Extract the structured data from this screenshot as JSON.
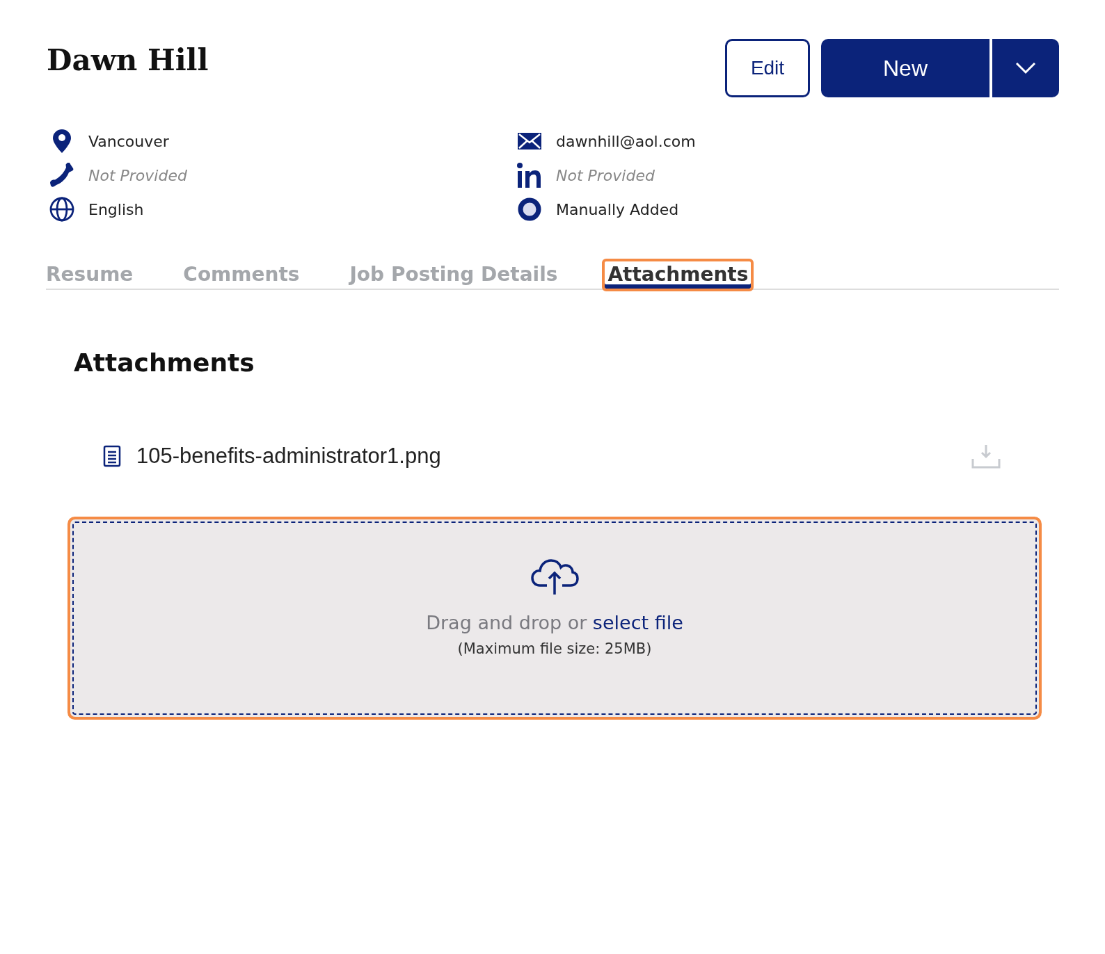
{
  "header": {
    "name": "Dawn Hill",
    "buttons": [
      {
        "kind": "outline",
        "label": "Edit"
      },
      {
        "kind": "split",
        "label": "New"
      }
    ]
  },
  "details": [
    {
      "kind": "location",
      "text": "Vancouver",
      "missing": false
    },
    {
      "kind": "email",
      "text": "dawnhill@aol.com",
      "missing": false
    },
    {
      "kind": "phone",
      "text": "Not Provided",
      "missing": true
    },
    {
      "kind": "linkedin",
      "text": "Not Provided",
      "missing": true
    },
    {
      "kind": "language",
      "text": "English",
      "missing": false
    },
    {
      "kind": "source",
      "text": "Manually Added",
      "missing": false
    }
  ],
  "tabs": [
    {
      "label": "Resume",
      "selected": false,
      "highlighted": false
    },
    {
      "label": "Comments",
      "selected": false,
      "highlighted": false
    },
    {
      "label": "Job Posting Details",
      "selected": false,
      "highlighted": false
    },
    {
      "label": "Attachments",
      "selected": true,
      "highlighted": true
    }
  ],
  "section": {
    "title": "Attachments"
  },
  "files": [
    {
      "name": "105-benefits-administrator1.png"
    }
  ],
  "dropzone": {
    "highlighted": true,
    "text": "Drag and drop or ",
    "link": "select file",
    "note": "(Maximum file size: 25MB)"
  }
}
